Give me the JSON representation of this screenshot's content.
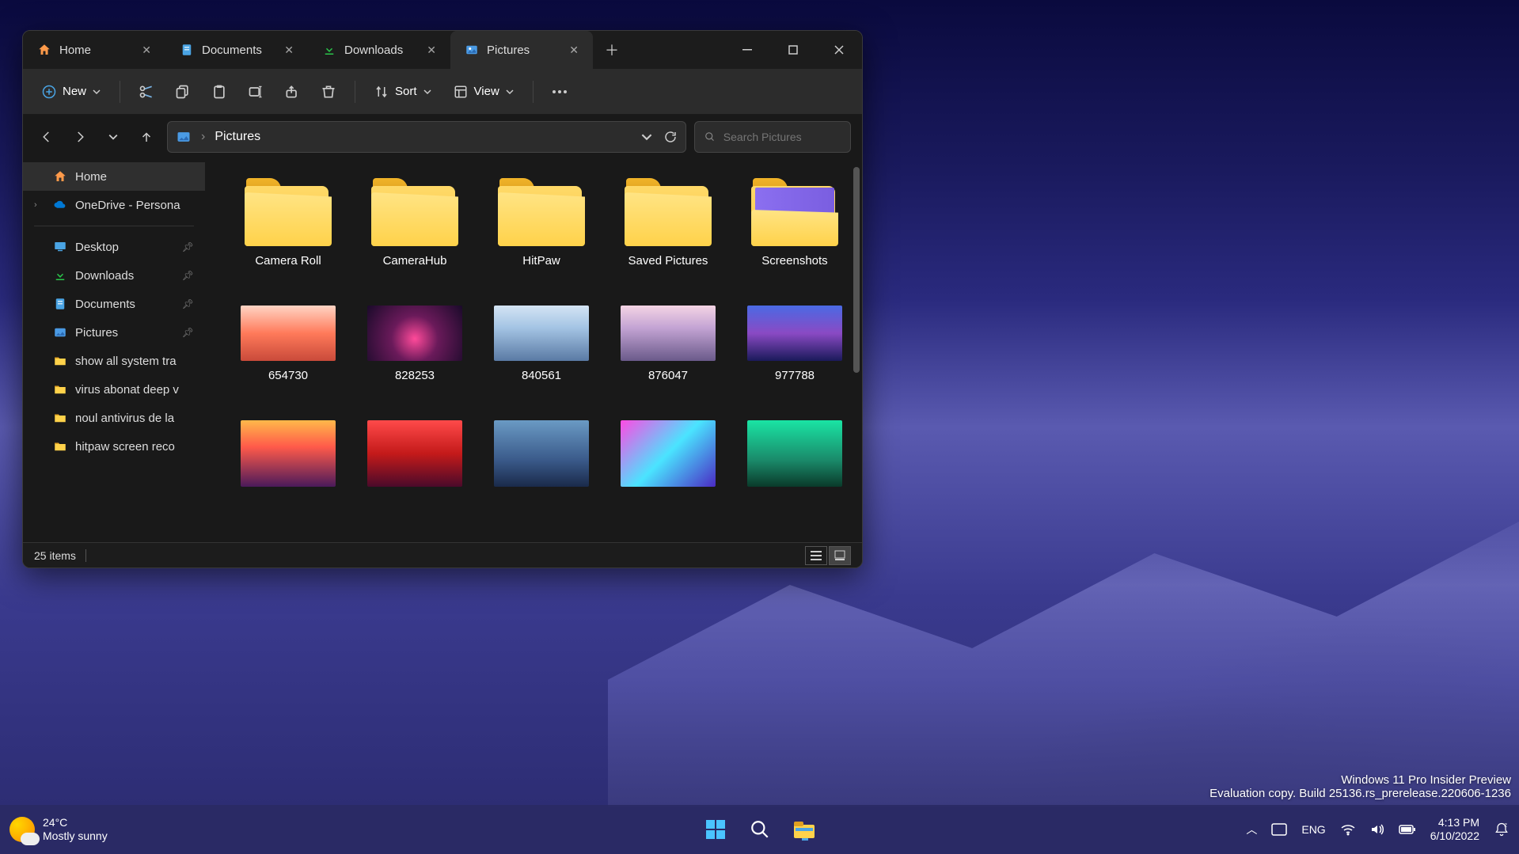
{
  "window": {
    "tabs": [
      {
        "label": "Home",
        "icon": "home"
      },
      {
        "label": "Documents",
        "icon": "documents"
      },
      {
        "label": "Downloads",
        "icon": "downloads"
      },
      {
        "label": "Pictures",
        "icon": "pictures",
        "active": true
      }
    ]
  },
  "toolbar": {
    "new_label": "New",
    "sort_label": "Sort",
    "view_label": "View"
  },
  "breadcrumb": {
    "location": "Pictures"
  },
  "search": {
    "placeholder": "Search Pictures"
  },
  "sidebar": {
    "home": "Home",
    "onedrive": "OneDrive - Persona",
    "quick": [
      {
        "label": "Desktop",
        "pinned": true,
        "icon": "desktop"
      },
      {
        "label": "Downloads",
        "pinned": true,
        "icon": "downloads"
      },
      {
        "label": "Documents",
        "pinned": true,
        "icon": "documents"
      },
      {
        "label": "Pictures",
        "pinned": true,
        "icon": "pictures"
      },
      {
        "label": "show all system tra",
        "pinned": false,
        "icon": "folder"
      },
      {
        "label": "virus abonat deep v",
        "pinned": false,
        "icon": "folder"
      },
      {
        "label": "noul antivirus de la",
        "pinned": false,
        "icon": "folder"
      },
      {
        "label": "hitpaw screen reco",
        "pinned": false,
        "icon": "folder"
      }
    ]
  },
  "content": {
    "folders": [
      {
        "name": "Camera Roll"
      },
      {
        "name": "CameraHub"
      },
      {
        "name": "HitPaw"
      },
      {
        "name": "Saved Pictures"
      },
      {
        "name": "Screenshots",
        "preview": true
      }
    ],
    "images_row1": [
      {
        "name": "654730",
        "gradient": "linear-gradient(180deg,#ffd4c4 0%,#ff7a5a 50%,#c94a3a 100%)"
      },
      {
        "name": "828253",
        "gradient": "radial-gradient(circle at 50% 60%,#ff4a9a 0%,#6a1a5a 40%,#1a0a2a 100%)"
      },
      {
        "name": "840561",
        "gradient": "linear-gradient(180deg,#d4e4f4 0%,#a4c4e4 40%,#5a7aa4 100%)"
      },
      {
        "name": "876047",
        "gradient": "linear-gradient(180deg,#f4d4e4 0%,#c4a4d4 40%,#6a5a8a 100%)"
      },
      {
        "name": "977788",
        "gradient": "linear-gradient(180deg,#4a6ae4 0%,#8a4ac4 50%,#1a1a5a 100%)"
      }
    ],
    "images_row2": [
      {
        "gradient": "linear-gradient(180deg,#ffb84a 0%,#ff5a4a 40%,#4a1a5a 100%)"
      },
      {
        "gradient": "linear-gradient(180deg,#ff4a4a 0%,#c41a1a 50%,#4a0a2a 100%)"
      },
      {
        "gradient": "linear-gradient(180deg,#6a9ac4 0%,#3a5a8a 60%,#1a2a4a 100%)"
      },
      {
        "gradient": "linear-gradient(135deg,#ff4ae4 0%,#4ae4ff 50%,#4a2ac4 100%)"
      },
      {
        "gradient": "linear-gradient(180deg,#1ae4a4 0%,#1a8a6a 60%,#0a3a2a 100%)"
      }
    ]
  },
  "statusbar": {
    "count": "25 items"
  },
  "watermark": {
    "line1": "Windows 11 Pro Insider Preview",
    "line2": "Evaluation copy. Build 25136.rs_prerelease.220606-1236"
  },
  "taskbar": {
    "weather_temp": "24°C",
    "weather_desc": "Mostly sunny",
    "lang": "ENG",
    "time": "4:13 PM",
    "date": "6/10/2022"
  }
}
